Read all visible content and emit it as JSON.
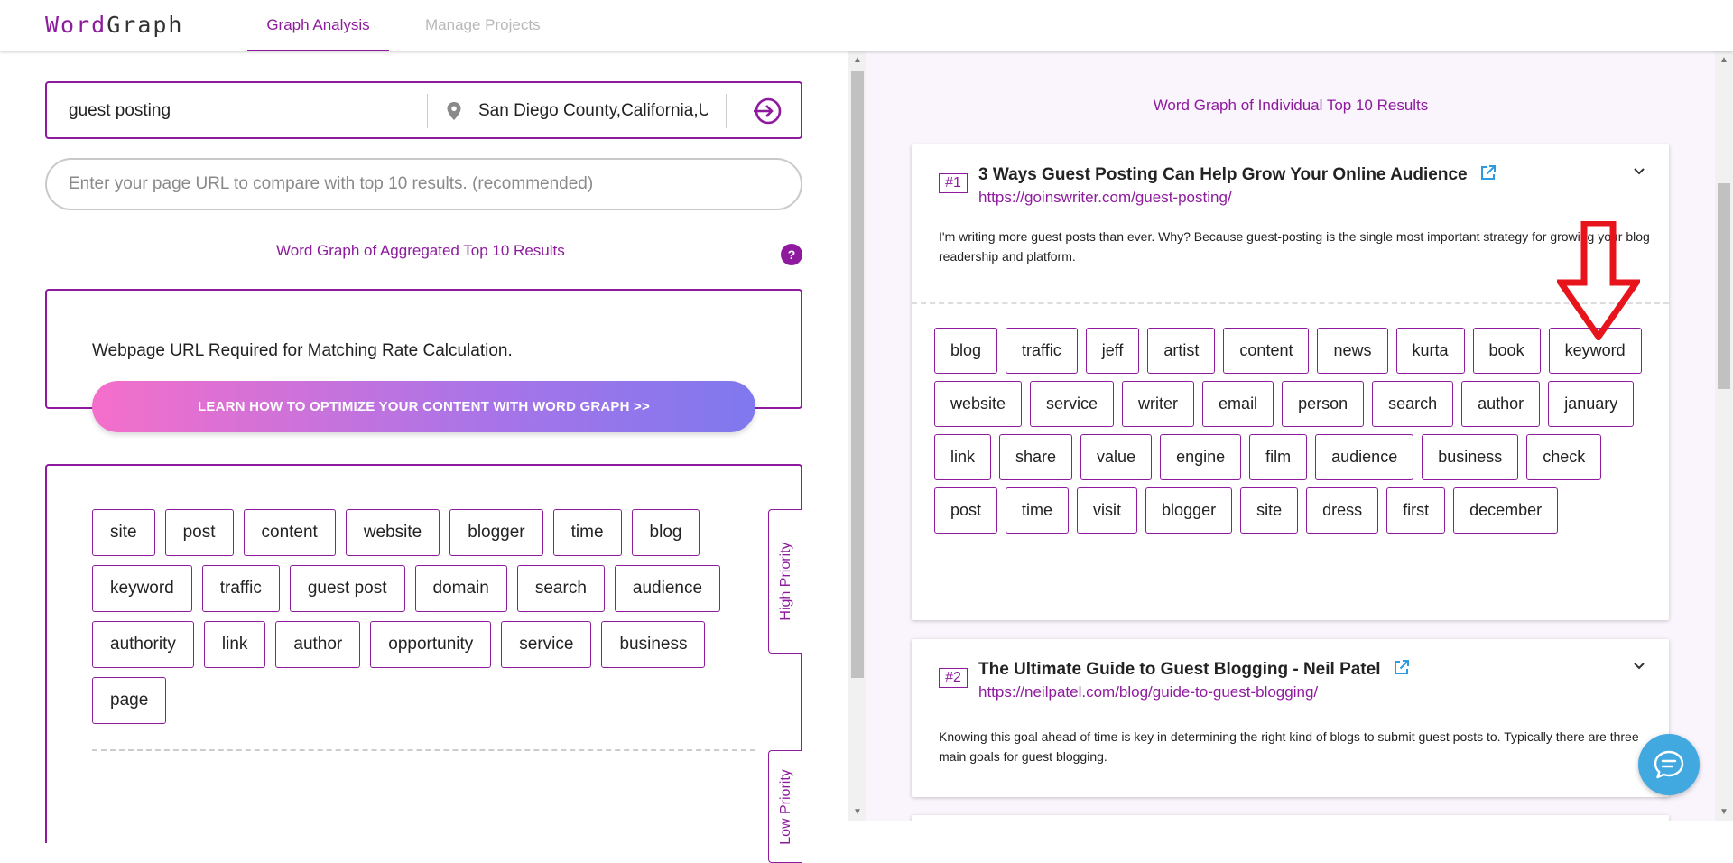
{
  "header": {
    "logo_word": "Word",
    "logo_graph": "Graph",
    "tabs": [
      {
        "label": "Graph Analysis",
        "active": true
      },
      {
        "label": "Manage Projects",
        "active": false
      }
    ]
  },
  "search": {
    "keyword": "guest posting",
    "location": "San Diego County,California,United States",
    "url_placeholder": "Enter your page URL to compare with top 10 results. (recommended)"
  },
  "aggregated": {
    "title": "Word Graph of Aggregated Top 10 Results",
    "help_label": "?",
    "notice": "Webpage URL Required for Matching Rate Calculation.",
    "learn_button": "LEARN HOW TO OPTIMIZE YOUR CONTENT WITH WORD GRAPH >>",
    "tags": [
      "site",
      "post",
      "content",
      "website",
      "blogger",
      "time",
      "blog",
      "keyword",
      "traffic",
      "guest post",
      "domain",
      "search",
      "audience",
      "authority",
      "link",
      "author",
      "opportunity",
      "service",
      "business",
      "page"
    ],
    "high_priority_label": "High Priority",
    "low_priority_label": "Low Priority"
  },
  "individual": {
    "title": "Word Graph of Individual Top 10 Results",
    "results": [
      {
        "rank": "#1",
        "title": "3 Ways Guest Posting Can Help Grow Your Online Audience",
        "url": "https://goinswriter.com/guest-posting/",
        "snippet": "I'm writing more guest posts than ever. Why? Because guest-posting is the single most important strategy for growing your blog readership and platform.",
        "tags": [
          "blog",
          "traffic",
          "jeff",
          "artist",
          "content",
          "news",
          "kurta",
          "book",
          "keyword",
          "website",
          "service",
          "writer",
          "email",
          "person",
          "search",
          "author",
          "january",
          "link",
          "share",
          "value",
          "engine",
          "film",
          "audience",
          "business",
          "check",
          "post",
          "time",
          "visit",
          "blogger",
          "site",
          "dress",
          "first",
          "december"
        ]
      },
      {
        "rank": "#2",
        "title": "The Ultimate Guide to Guest Blogging - Neil Patel",
        "url": "https://neilpatel.com/blog/guide-to-guest-blogging/",
        "snippet": "Knowing this goal ahead of time is key in determining the right kind of blogs to submit guest posts to. Typically there are three main goals for guest blogging."
      }
    ]
  },
  "colors": {
    "accent": "#8e1b9e",
    "chat": "#41a8e0",
    "arrow": "#e8141b",
    "gradient_start": "#f56fca",
    "gradient_end": "#7f78ee"
  }
}
